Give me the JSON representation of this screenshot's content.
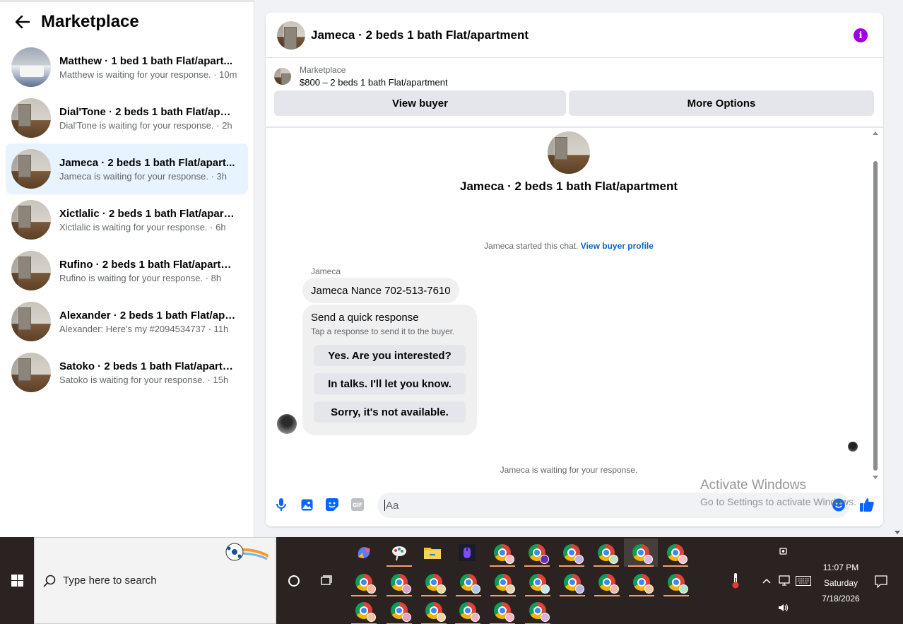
{
  "sidebar": {
    "title": "Marketplace",
    "conversations": [
      {
        "name": "Matthew · 1 bed 1 bath Flat/apart...",
        "status": "Matthew is waiting for your response. · 10m"
      },
      {
        "name": "Dial'Tone · 2 beds 1 bath Flat/apart...",
        "status": "Dial'Tone is waiting for your response. · 2h"
      },
      {
        "name": "Jameca · 2 beds 1 bath Flat/apart...",
        "status": "Jameca is waiting for your response. · 3h"
      },
      {
        "name": "Xictlalic · 2 beds 1 bath Flat/apart...",
        "status": "Xictlalic is waiting for your response. · 6h"
      },
      {
        "name": "Rufino · 2 beds 1 bath Flat/apartm...",
        "status": "Rufino is waiting for your response. · 8h"
      },
      {
        "name": "Alexander · 2 beds 1 bath Flat/apa...",
        "status": "Alexander: Here's my #2094534737 · 11h"
      },
      {
        "name": "Satoko · 2 beds 1 bath Flat/apartm...",
        "status": "Satoko is waiting for your response. · 15h"
      }
    ]
  },
  "chat": {
    "title": "Jameca · 2 beds 1 bath Flat/apartment",
    "listing_label": "Marketplace",
    "listing_price": "$800 – 2 beds 1 bath Flat/apartment",
    "view_buyer": "View buyer",
    "more_options": "More Options",
    "intro_title": "Jameca · 2 beds 1 bath Flat/apartment",
    "started_text": "Jameca started this chat.",
    "view_profile": "View buyer profile",
    "sender": "Jameca",
    "message": "Jameca Nance 702-513-7610",
    "quick_title": "Send a quick response",
    "quick_sub": "Tap a response to send it to the buyer.",
    "quick_responses": [
      "Yes. Are you interested?",
      "In talks. I'll let you know.",
      "Sorry, it's not available."
    ],
    "waiting": "Jameca is waiting for your response.",
    "input_placeholder": "Aa"
  },
  "watermark": {
    "line1": "Activate Windows",
    "line2": "Go to Settings to activate Windows."
  },
  "taskbar": {
    "search_placeholder": "Type here to search",
    "time": "11:07 PM",
    "day": "Saturday",
    "date": "7/18/2026"
  },
  "colors": {
    "accent_blue": "#0866ff",
    "info_purple": "#a100e0",
    "active_bg": "#e7f3ff"
  }
}
